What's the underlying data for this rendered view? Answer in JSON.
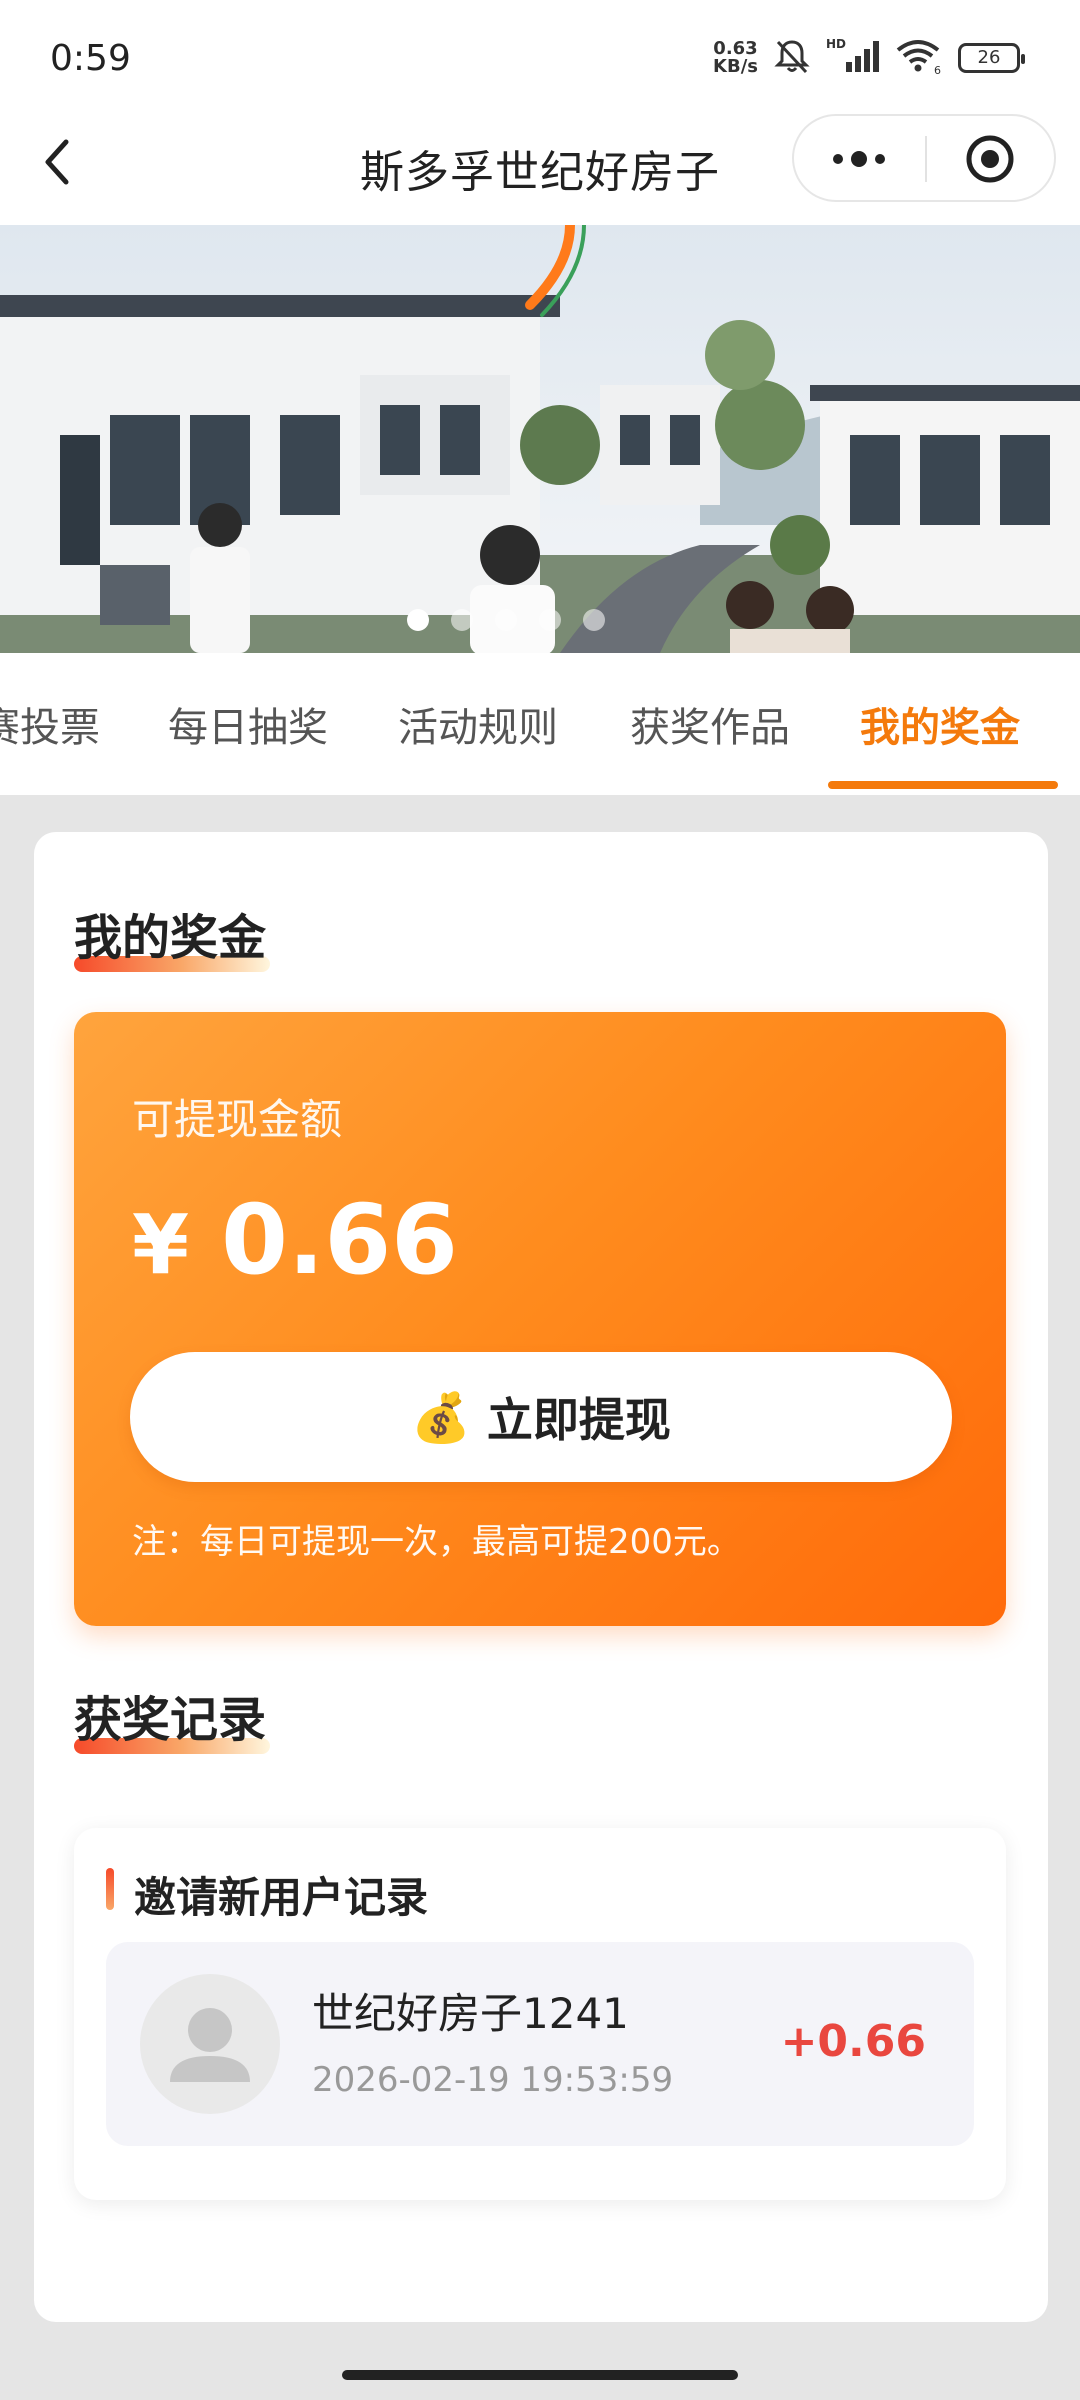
{
  "status_bar": {
    "time": "0:59",
    "net_speed_value": "0.63",
    "net_speed_unit": "KB/s",
    "signal_label": "HD",
    "wifi_label": "6",
    "battery": "26"
  },
  "nav": {
    "title": "斯多孚世纪好房子"
  },
  "banner": {
    "dot_count": 5,
    "active_dot": 0
  },
  "tabs": [
    {
      "label": "赛投票"
    },
    {
      "label": "每日抽奖"
    },
    {
      "label": "活动规则"
    },
    {
      "label": "获奖作品"
    },
    {
      "label": "我的奖金"
    }
  ],
  "active_tab": 4,
  "my_bonus": {
    "section_title": "我的奖金",
    "withdrawable_label": "可提现金额",
    "currency_symbol": "¥",
    "amount": "0.66",
    "withdraw_button": "立即提现",
    "withdraw_icon": "money-bag-icon",
    "note": "注：每日可提现一次，最高可提200元。"
  },
  "records": {
    "section_title": "获奖记录",
    "card_title": "邀请新用户记录",
    "items": [
      {
        "name": "世纪好房子1241",
        "time": "2026-02-19 19:53:59",
        "amount": "+0.66"
      }
    ]
  },
  "colors": {
    "accent": "#f47a0c",
    "amount_red": "#e9473f",
    "card_gradient_start": "#ffa43d",
    "card_gradient_end": "#ff6a0a"
  }
}
